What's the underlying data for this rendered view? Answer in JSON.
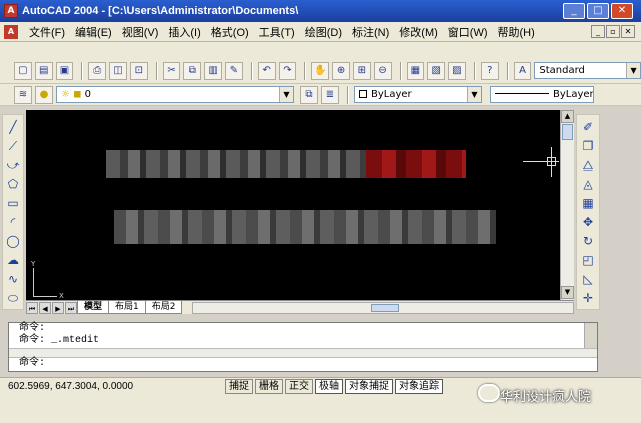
{
  "window": {
    "title": "AutoCAD 2004 - [C:\\Users\\Administrator\\Documents\\"
  },
  "menu": [
    "文件(F)",
    "编辑(E)",
    "视图(V)",
    "插入(I)",
    "格式(O)",
    "工具(T)",
    "绘图(D)",
    "标注(N)",
    "修改(M)",
    "窗口(W)",
    "帮助(H)"
  ],
  "toolbar": {
    "text_style": "Standard",
    "layer": "0",
    "color": "ByLayer",
    "linetype": "ByLayer"
  },
  "tabs": [
    "模型",
    "布局1",
    "布局2"
  ],
  "ucs": {
    "x": "X",
    "y": "Y"
  },
  "command": {
    "lines": [
      "命令:",
      "命令: _.mtedit",
      "命令:"
    ]
  },
  "status": {
    "coords": "602.5969, 647.3004, 0.0000",
    "buttons": [
      "捕捉",
      "栅格",
      "正交",
      "极轴",
      "对象捕捉",
      "对象追踪"
    ]
  },
  "watermark": "华利设计疯人院"
}
